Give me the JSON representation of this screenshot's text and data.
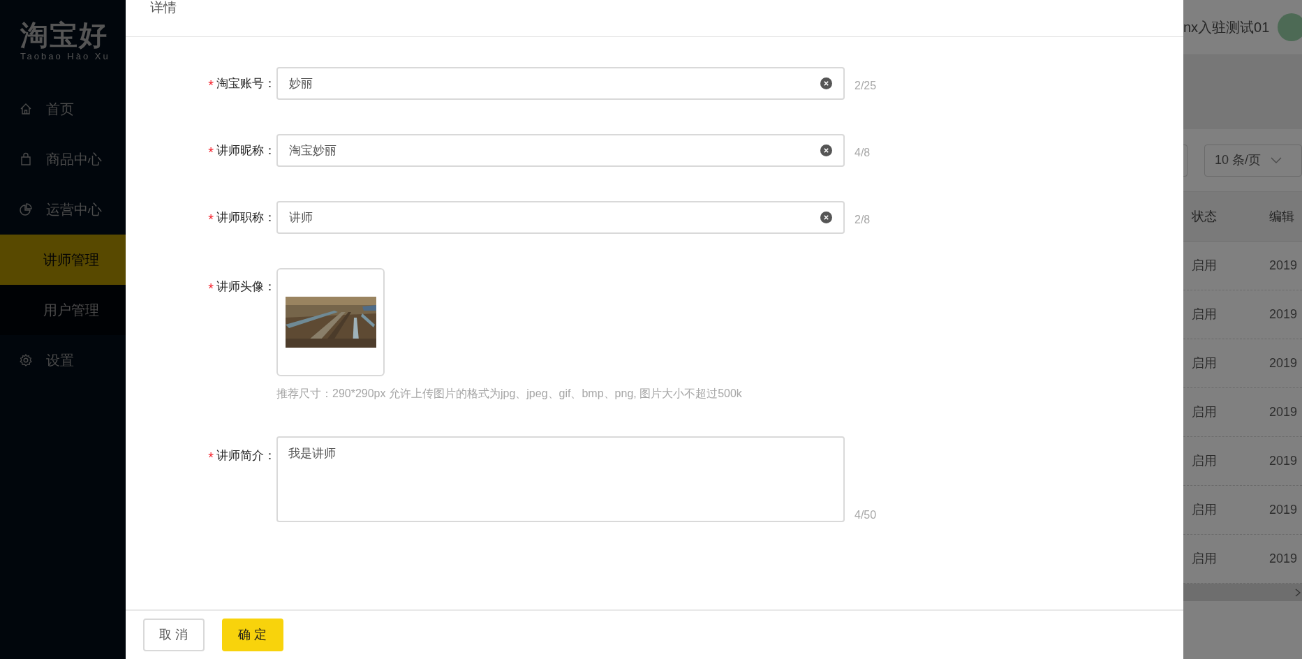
{
  "sidebar": {
    "logo": "淘宝好",
    "logo_subtitle": "Taobao Hào Xu",
    "items": [
      {
        "label": "首页",
        "selected": false
      },
      {
        "label": "商品中心",
        "selected": false
      },
      {
        "label": "运营中心",
        "selected": false,
        "children": [
          {
            "label": "讲师管理",
            "selected": true
          },
          {
            "label": "用户管理",
            "selected": false
          }
        ]
      },
      {
        "label": "设置",
        "selected": false
      }
    ]
  },
  "header": {
    "user_name": "nx入驻测试01"
  },
  "pagination": {
    "page_size": "10 条/页"
  },
  "table": {
    "columns": [
      "状态",
      "编辑"
    ],
    "rows": [
      {
        "status": "启用",
        "column_2": "2019"
      },
      {
        "status": "启用",
        "column_2": "2019"
      },
      {
        "status": "启用",
        "column_2": "2019"
      },
      {
        "status": "启用",
        "column_2": "2019"
      },
      {
        "status": "启用",
        "column_2": "2019"
      },
      {
        "status": "启用",
        "column_2": "2019"
      },
      {
        "status": "启用",
        "column_2": "2019"
      }
    ]
  },
  "drawer": {
    "title": "详情",
    "fields": [
      {
        "kind": "input",
        "required_mark": "*",
        "label": "淘宝账号：",
        "value": "妙丽",
        "counter": "2/25"
      },
      {
        "kind": "input",
        "required_mark": "*",
        "label": "讲师昵称：",
        "value": "淘宝妙丽",
        "counter": "4/8"
      },
      {
        "kind": "input",
        "required_mark": "*",
        "label": "讲师职称：",
        "value": "讲师",
        "counter": "2/8"
      },
      {
        "kind": "upload",
        "required_mark": "*",
        "label": "讲师头像：",
        "hint": "推荐尺寸：290*290px 允许上传图片的格式为jpg、jpeg、gif、bmp、png, 图片大小不超过500k"
      },
      {
        "kind": "textarea",
        "required_mark": "*",
        "label": "讲师简介：",
        "value": "我是讲师",
        "counter": "4/50"
      }
    ],
    "buttons": [
      {
        "label": "取 消",
        "kind": "secondary"
      },
      {
        "label": "确 定",
        "kind": "primary"
      }
    ]
  }
}
